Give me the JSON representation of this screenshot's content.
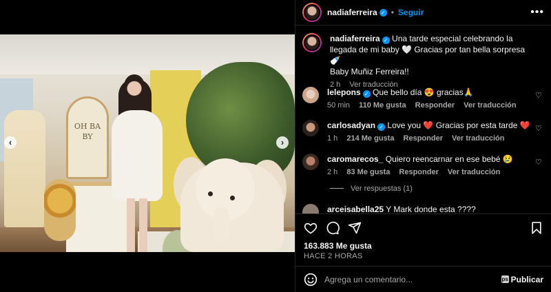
{
  "post": {
    "username": "nadiaferreira",
    "follow_label": "Seguir",
    "caption": "Una tarde especial celebrando la llegada de mi baby 🤍 Gracias por tan bella sorpresa 🍼",
    "caption_line2": "Baby Muñiz Ferreira!!",
    "caption_time": "2 h",
    "caption_translate": "Ver traducción",
    "photo_text": "OH BA BY",
    "likes": "163.883 Me gusta",
    "time_ago": "HACE 2 HORAS"
  },
  "comments": [
    {
      "username": "lelepons",
      "verified": true,
      "text": "Que bello día 😍 gracias🙏",
      "time": "50 min",
      "likes": "110 Me gusta",
      "reply": "Responder",
      "translate": "Ver traducción"
    },
    {
      "username": "carlosadyan",
      "verified": true,
      "text": "Love you ❤️ Gracias por esta tarde ❤️",
      "time": "1 h",
      "likes": "214 Me gusta",
      "reply": "Responder",
      "translate": "Ver traducción"
    },
    {
      "username": "caromarecos_",
      "verified": false,
      "text": "Quiero reencarnar en ese bebé 😢",
      "time": "2 h",
      "likes": "83 Me gusta",
      "reply": "Responder",
      "translate": "Ver traducción"
    },
    {
      "username": "arceisabella25",
      "verified": false,
      "text": "Y Mark donde esta ????",
      "time": "",
      "likes": "",
      "reply": "",
      "translate": ""
    }
  ],
  "view_replies": "Ver respuestas (1)",
  "composer": {
    "placeholder": "Agrega un comentario...",
    "publish_label": "Publicar"
  },
  "icons": {
    "like": "heart-icon",
    "comment": "comment-icon",
    "share": "send-icon",
    "save": "bookmark-icon",
    "emoji": "emoji-icon",
    "more": "more-icon"
  },
  "colors": {
    "accent": "#0095f6",
    "background": "#000000",
    "muted": "#a8a8a8"
  }
}
